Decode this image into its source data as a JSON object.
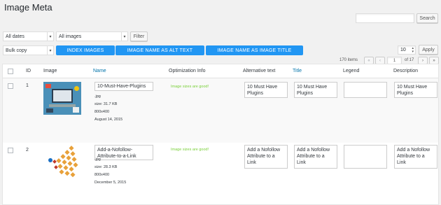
{
  "page": {
    "title": "Image Meta"
  },
  "search": {
    "button_label": "Search",
    "value": ""
  },
  "filters": {
    "dates_label": "All dates",
    "images_label": "All images",
    "filter_button": "Filter"
  },
  "bulk": {
    "action_label": "Bulk copy",
    "index_images": "INDEX IMAGES",
    "name_as_alt": "IMAGE NAME AS ALT TEXT",
    "name_as_title": "IMAGE NAME AS IMAGE TITLE"
  },
  "per_page": {
    "value": "10",
    "apply": "Apply"
  },
  "pagination": {
    "items": "170 items",
    "first": "«",
    "prev": "‹",
    "current": "1",
    "of": "of 17",
    "next": "›",
    "last": "»"
  },
  "columns": {
    "id": "ID",
    "image": "Image",
    "name": "Name",
    "optimization": "Optimization Info",
    "alt": "Alternative text",
    "title": "Title",
    "legend": "Legend",
    "description": "Description"
  },
  "rows": [
    {
      "id": "1",
      "name": "10-Must-Have-Plugins",
      "ext": ".jpg",
      "size": "size: 31.7 KB",
      "dims": "800x400",
      "date": "August 14, 2015",
      "optimization": "Image sizes are good!",
      "alt": "10 Must Have Plugins",
      "title": "10 Must Have Plugins",
      "legend": "",
      "description": "10 Must Have Plugins"
    },
    {
      "id": "2",
      "name": "Add-a-Nofollow-Attribute-to-a-Link",
      "ext": ".jpg",
      "size": "size: 28.3 KB",
      "dims": "800x400",
      "date": "December 5, 2015",
      "optimization": "Image sizes are good!",
      "alt": "Add a Nofollow Attribute to a Link",
      "title": "Add a Nofollow Attribute to a Link",
      "legend": "",
      "description": "Add a Nofollow Attribute to a Link"
    }
  ],
  "colors": {
    "accent": "#2196f3",
    "link": "#0073aa",
    "ok": "#7ad03a"
  }
}
